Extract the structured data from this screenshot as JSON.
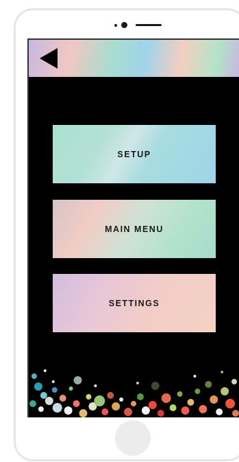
{
  "screen": {
    "back_icon": "back-arrow-icon",
    "buttons": [
      {
        "label": "SETUP"
      },
      {
        "label": "MAIN MENU"
      },
      {
        "label": "SETTINGS"
      }
    ]
  },
  "device": {
    "home_button_icon": "home-button"
  },
  "colors": {
    "screen_background": "#000000",
    "text": "#1a1a1a",
    "frame": "#e6e6e6"
  }
}
